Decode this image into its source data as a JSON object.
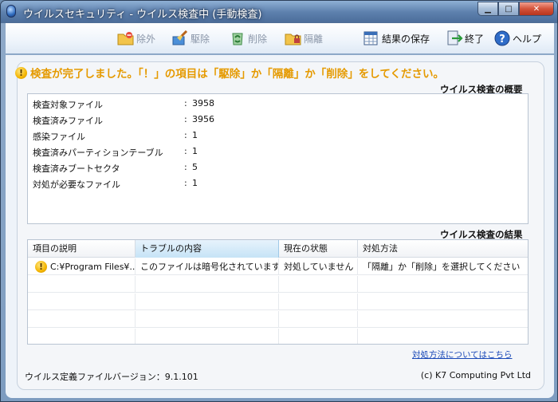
{
  "window": {
    "title": "ウイルスセキュリティ - ウイルス検査中 (手動検査)"
  },
  "toolbar": {
    "exclude_label": "除外",
    "disinfect_label": "駆除",
    "delete_label": "削除",
    "quarantine_label": "隔離",
    "save_results_label": "結果の保存",
    "exit_label": "終了",
    "help_label": "ヘルプ"
  },
  "alert": {
    "message": "検査が完了しました。「！」の項目は「駆除」か「隔離」か「削除」をしてください。"
  },
  "summary": {
    "title": "ウイルス検査の概要",
    "rows": [
      {
        "label": "検査対象ファイル",
        "value": "3958"
      },
      {
        "label": "検査済みファイル",
        "value": "3956"
      },
      {
        "label": "感染ファイル",
        "value": "1"
      },
      {
        "label": "検査済みパーティションテーブル",
        "value": "1"
      },
      {
        "label": "検査済みブートセクタ",
        "value": "5"
      },
      {
        "label": "対処が必要なファイル",
        "value": "1"
      }
    ],
    "separator": ":"
  },
  "results": {
    "title": "ウイルス検査の結果",
    "columns": [
      "項目の説明",
      "トラブルの内容",
      "現在の状態",
      "対処方法"
    ],
    "rows": [
      {
        "item": "C:¥Program Files¥...",
        "problem": "このファイルは暗号化されています...",
        "status": "対処していません",
        "action": "「隔離」か「削除」を選択してください"
      }
    ]
  },
  "links": {
    "how_to": "対処方法についてはこちら"
  },
  "footer": {
    "definition_version": "ウイルス定義ファイルバージョン：9.1.101",
    "copyright": "(c) K7 Computing Pvt Ltd"
  },
  "colors": {
    "alert": "#e59a00",
    "accent": "#4f6f98",
    "link": "#1a49b8"
  },
  "icons": {
    "exclude": "folder-exclude-icon",
    "disinfect": "brush-icon",
    "delete": "recycle-icon",
    "quarantine": "folder-lock-icon",
    "save": "table-save-icon",
    "exit": "exit-arrow-icon",
    "help": "question-icon",
    "warning": "warning-icon"
  }
}
